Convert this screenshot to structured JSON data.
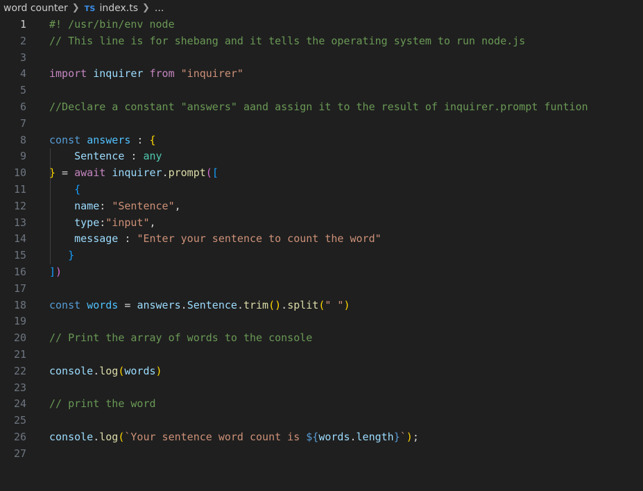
{
  "breadcrumb": {
    "folder": "word counter",
    "file_badge": "TS",
    "file": "index.ts",
    "more": "..."
  },
  "editor": {
    "active_line": 1,
    "lines": [
      [
        {
          "t": "#! /usr/bin/env node",
          "c": "comment"
        }
      ],
      [
        {
          "t": "// This line is for shebang and it tells the operating system to run node.js",
          "c": "comment"
        }
      ],
      [],
      [
        {
          "t": "import",
          "c": "kw-purple"
        },
        {
          "t": " ",
          "c": "punc"
        },
        {
          "t": "inquirer",
          "c": "var"
        },
        {
          "t": " ",
          "c": "punc"
        },
        {
          "t": "from",
          "c": "kw-purple"
        },
        {
          "t": " ",
          "c": "punc"
        },
        {
          "t": "\"inquirer\"",
          "c": "str"
        }
      ],
      [],
      [
        {
          "t": "//Declare a constant \"answers\" aand assign it to the result of inquirer.prompt funtion",
          "c": "comment"
        }
      ],
      [],
      [
        {
          "t": "const",
          "c": "kw-blue"
        },
        {
          "t": " ",
          "c": "punc"
        },
        {
          "t": "answers",
          "c": "const"
        },
        {
          "t": " : ",
          "c": "punc"
        },
        {
          "t": "{",
          "c": "b1"
        }
      ],
      [
        {
          "t": "    ",
          "c": "punc"
        },
        {
          "t": "Sentence",
          "c": "var"
        },
        {
          "t": " : ",
          "c": "punc"
        },
        {
          "t": "any",
          "c": "type"
        }
      ],
      [
        {
          "t": "}",
          "c": "b1"
        },
        {
          "t": " = ",
          "c": "punc"
        },
        {
          "t": "await",
          "c": "kw-purple"
        },
        {
          "t": " ",
          "c": "punc"
        },
        {
          "t": "inquirer",
          "c": "var"
        },
        {
          "t": ".",
          "c": "punc"
        },
        {
          "t": "prompt",
          "c": "fn"
        },
        {
          "t": "(",
          "c": "b2"
        },
        {
          "t": "[",
          "c": "b3"
        }
      ],
      [
        {
          "t": "    ",
          "c": "punc"
        },
        {
          "t": "{",
          "c": "b3"
        }
      ],
      [
        {
          "t": "    ",
          "c": "punc"
        },
        {
          "t": "name",
          "c": "var"
        },
        {
          "t": ": ",
          "c": "punc"
        },
        {
          "t": "\"Sentence\"",
          "c": "str"
        },
        {
          "t": ",",
          "c": "punc"
        }
      ],
      [
        {
          "t": "    ",
          "c": "punc"
        },
        {
          "t": "type",
          "c": "var"
        },
        {
          "t": ":",
          "c": "punc"
        },
        {
          "t": "\"input\"",
          "c": "str"
        },
        {
          "t": ",",
          "c": "punc"
        }
      ],
      [
        {
          "t": "    ",
          "c": "punc"
        },
        {
          "t": "message",
          "c": "var"
        },
        {
          "t": " : ",
          "c": "punc"
        },
        {
          "t": "\"Enter your sentence to count the word\"",
          "c": "str"
        }
      ],
      [
        {
          "t": "   ",
          "c": "punc"
        },
        {
          "t": "}",
          "c": "b3"
        }
      ],
      [
        {
          "t": "]",
          "c": "b3"
        },
        {
          "t": ")",
          "c": "b2"
        }
      ],
      [],
      [
        {
          "t": "const",
          "c": "kw-blue"
        },
        {
          "t": " ",
          "c": "punc"
        },
        {
          "t": "words",
          "c": "const"
        },
        {
          "t": " = ",
          "c": "punc"
        },
        {
          "t": "answers",
          "c": "var"
        },
        {
          "t": ".",
          "c": "punc"
        },
        {
          "t": "Sentence",
          "c": "var"
        },
        {
          "t": ".",
          "c": "punc"
        },
        {
          "t": "trim",
          "c": "fn"
        },
        {
          "t": "()",
          "c": "b1"
        },
        {
          "t": ".",
          "c": "punc"
        },
        {
          "t": "split",
          "c": "fn"
        },
        {
          "t": "(",
          "c": "b1"
        },
        {
          "t": "\" \"",
          "c": "str"
        },
        {
          "t": ")",
          "c": "b1"
        }
      ],
      [],
      [
        {
          "t": "// Print the array of words to the console",
          "c": "comment"
        }
      ],
      [],
      [
        {
          "t": "console",
          "c": "var"
        },
        {
          "t": ".",
          "c": "punc"
        },
        {
          "t": "log",
          "c": "fn"
        },
        {
          "t": "(",
          "c": "b1"
        },
        {
          "t": "words",
          "c": "var"
        },
        {
          "t": ")",
          "c": "b1"
        }
      ],
      [],
      [
        {
          "t": "// print the word",
          "c": "comment"
        }
      ],
      [],
      [
        {
          "t": "console",
          "c": "var"
        },
        {
          "t": ".",
          "c": "punc"
        },
        {
          "t": "log",
          "c": "fn"
        },
        {
          "t": "(",
          "c": "b1"
        },
        {
          "t": "`Your sentence word count is ",
          "c": "str"
        },
        {
          "t": "${",
          "c": "kw-blue"
        },
        {
          "t": "words",
          "c": "var"
        },
        {
          "t": ".",
          "c": "punc"
        },
        {
          "t": "length",
          "c": "var"
        },
        {
          "t": "}",
          "c": "kw-blue"
        },
        {
          "t": "`",
          "c": "str"
        },
        {
          "t": ")",
          "c": "b1"
        },
        {
          "t": ";",
          "c": "punc"
        }
      ],
      []
    ]
  }
}
